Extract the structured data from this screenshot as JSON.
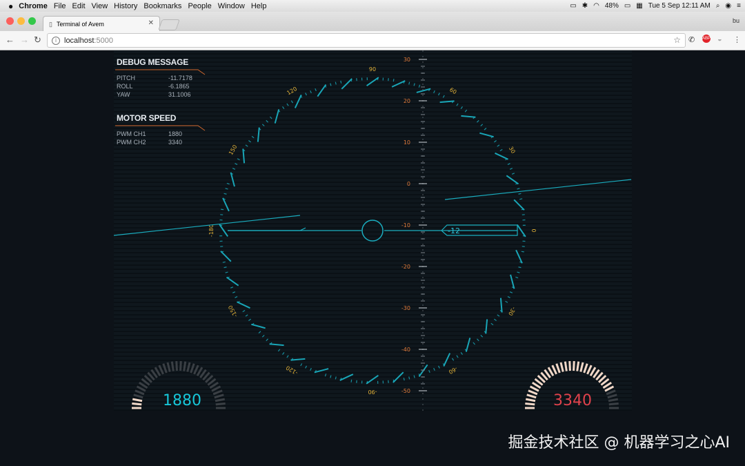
{
  "menubar": {
    "app": "Chrome",
    "items": [
      "File",
      "Edit",
      "View",
      "History",
      "Bookmarks",
      "People",
      "Window",
      "Help"
    ],
    "battery": "48%",
    "clock": "Tue 5 Sep  12:11 AM"
  },
  "browser": {
    "tab_title": "Terminal of Avem",
    "profile": "bu",
    "url_host": "localhost",
    "url_port": ":5000"
  },
  "debug": {
    "title": "DEBUG MESSAGE",
    "rows": [
      {
        "label": "PITCH",
        "value": "-11.7178"
      },
      {
        "label": "ROLL",
        "value": "-6.1865"
      },
      {
        "label": "YAW",
        "value": "31.1006"
      }
    ]
  },
  "motor": {
    "title": "MOTOR SPEED",
    "rows": [
      {
        "label": "PWM CH1",
        "value": "1880"
      },
      {
        "label": "PWM CH2",
        "value": "3340"
      }
    ]
  },
  "gauges": {
    "left_value": "1880",
    "right_value": "3340",
    "left_color": "#17c6d8",
    "right_color": "#e0424c"
  },
  "pitch_scale": {
    "labels": [
      "30",
      "20",
      "10",
      "0",
      "-10",
      "-20",
      "-30",
      "-40",
      "-50"
    ]
  },
  "compass": {
    "labels": [
      "0",
      "30",
      "60",
      "90",
      "120",
      "150",
      "180",
      "210",
      "240",
      "270",
      "300",
      "330"
    ]
  },
  "pitch_indicator": "-12",
  "colors": {
    "hud_cyan": "#1aaec0",
    "label_yellow": "#e3b238",
    "label_orange": "#e07a3a"
  },
  "watermark": "掘金技术社区 @ 机器学习之心AI"
}
